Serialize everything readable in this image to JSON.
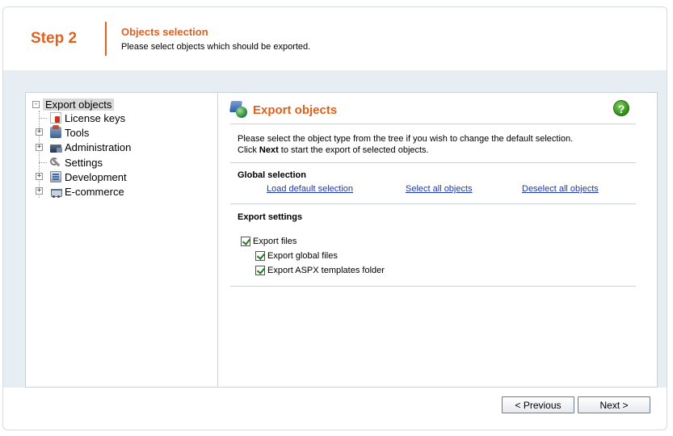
{
  "header": {
    "step_label": "Step 2",
    "title": "Objects selection",
    "description": "Please select objects which should be exported."
  },
  "tree": {
    "root": {
      "label": "Export objects",
      "expander": "-"
    },
    "items": [
      {
        "label": "License keys",
        "icon": "license-key-icon",
        "expander": ""
      },
      {
        "label": "Tools",
        "icon": "tools-icon",
        "expander": "+"
      },
      {
        "label": "Administration",
        "icon": "administration-icon",
        "expander": "+"
      },
      {
        "label": "Settings",
        "icon": "settings-wrench-icon",
        "expander": ""
      },
      {
        "label": "Development",
        "icon": "development-icon",
        "expander": "+"
      },
      {
        "label": "E-commerce",
        "icon": "shopping-cart-icon",
        "expander": "+"
      }
    ]
  },
  "main": {
    "title": "Export objects",
    "help": "?",
    "intro_line1": "Please select the object type from the tree if you wish to change the default selection.",
    "intro_line2_prefix": "Click ",
    "intro_line2_bold": "Next",
    "intro_line2_suffix": " to start the export of selected objects.",
    "global_selection": {
      "title": "Global selection",
      "load_default": "Load default selection",
      "select_all": "Select all objects",
      "deselect_all": "Deselect all objects"
    },
    "export_settings": {
      "title": "Export settings",
      "export_files": {
        "label": "Export files",
        "checked": true
      },
      "export_global_files": {
        "label": "Export global files",
        "checked": true
      },
      "export_aspx": {
        "label": "Export ASPX templates folder",
        "checked": true
      }
    }
  },
  "footer": {
    "previous": "< Previous",
    "next": "Next >"
  }
}
